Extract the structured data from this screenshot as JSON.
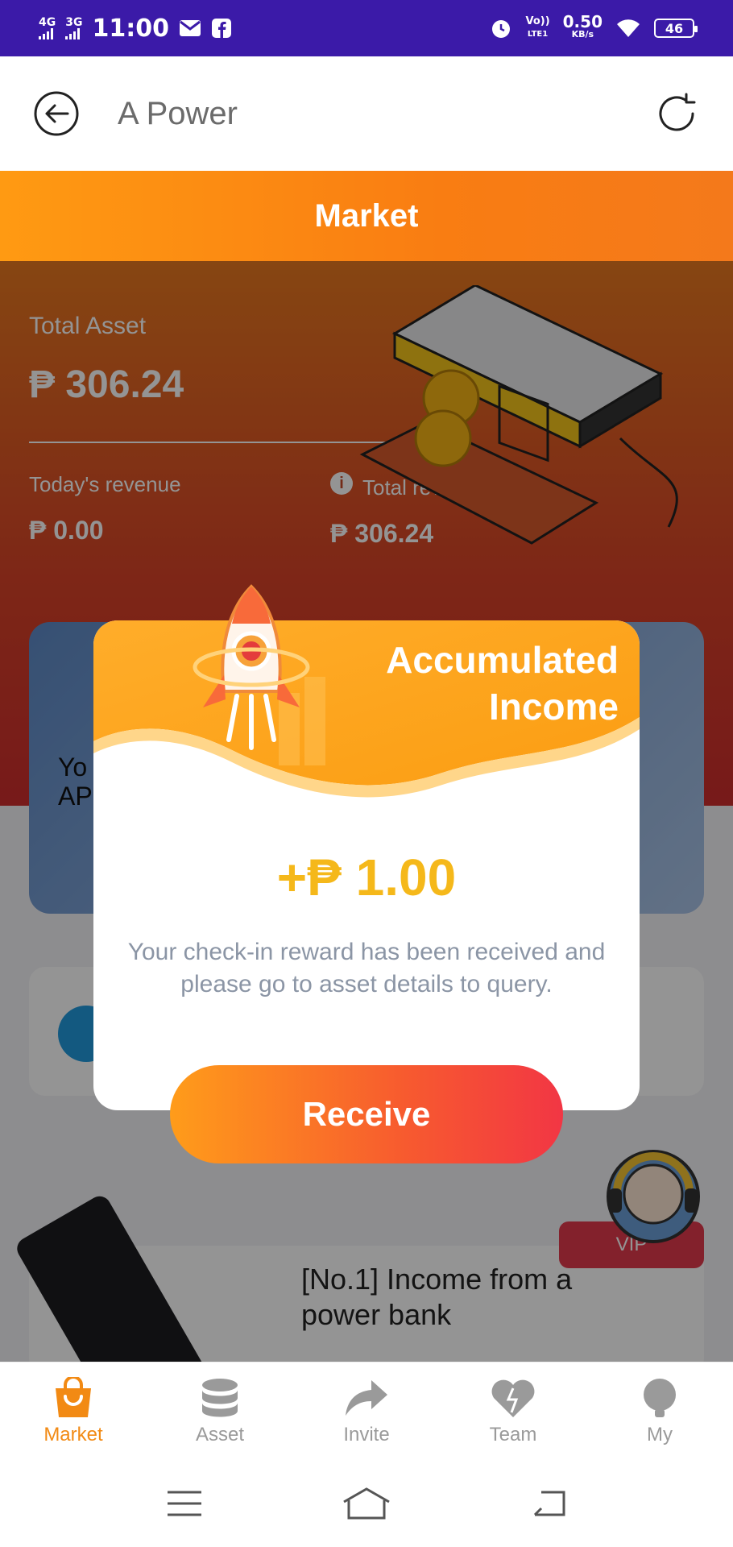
{
  "status_bar": {
    "net1": "4G",
    "net2": "3G",
    "time": "11:00",
    "volte_top": "Vo))",
    "volte_bottom": "LTE1",
    "speed_value": "0.50",
    "speed_unit": "KB/s",
    "battery": "46"
  },
  "header": {
    "title": "A Power"
  },
  "market_strip": {
    "title": "Market"
  },
  "dashboard": {
    "total_asset_label": "Total Asset",
    "total_asset_value": "₱ 306.24",
    "today_label": "Today's revenue",
    "today_value": "₱ 0.00",
    "total_revenue_label": "Total revenue",
    "total_revenue_value": "₱ 306.24"
  },
  "promo_card": {
    "line1": "Yo",
    "line2": "AP"
  },
  "product": {
    "title": "[No.1] Income from a power bank"
  },
  "vip": {
    "label": "VIP"
  },
  "modal": {
    "title_line1": "Accumulated",
    "title_line2": "Income",
    "amount": "+₱ 1.00",
    "message": "Your check-in reward has been received and please go to asset details to query.",
    "button": "Receive"
  },
  "bottom_nav": {
    "items": [
      {
        "label": "Market",
        "icon": "shopping-bag-icon",
        "active": true
      },
      {
        "label": "Asset",
        "icon": "database-icon",
        "active": false
      },
      {
        "label": "Invite",
        "icon": "share-arrow-icon",
        "active": false
      },
      {
        "label": "Team",
        "icon": "heart-icon",
        "active": false
      },
      {
        "label": "My",
        "icon": "user-icon",
        "active": false
      }
    ]
  },
  "colors": {
    "status_bar": "#3b1aa8",
    "accent_orange": "#f28a14",
    "amount_yellow": "#f5b81a",
    "button_red": "#f23644"
  }
}
